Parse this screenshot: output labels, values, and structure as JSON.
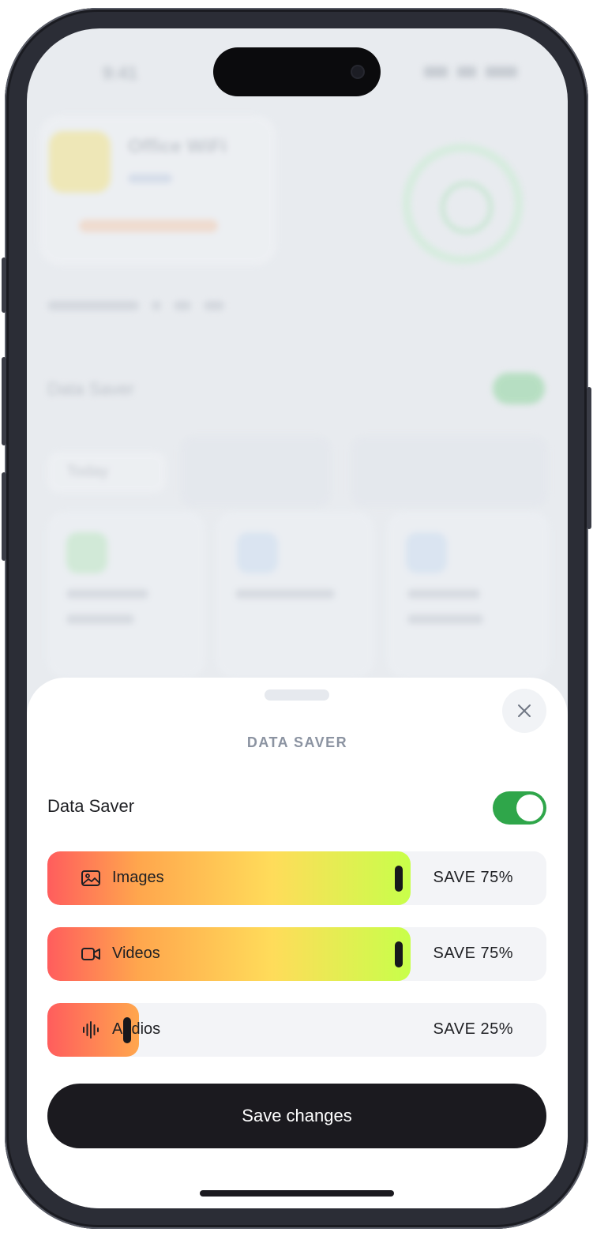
{
  "background": {
    "status_time": "9:41",
    "network_title": "Office WiFi",
    "data_saver_label": "Data Saver",
    "today_label": "Today"
  },
  "sheet": {
    "title": "DATA SAVER",
    "data_saver": {
      "label": "Data Saver",
      "enabled": true
    },
    "sliders": [
      {
        "icon": "image-icon",
        "label": "Images",
        "value_text": "SAVE 75%",
        "percent": 75
      },
      {
        "icon": "video-camera-icon",
        "label": "Videos",
        "value_text": "SAVE 75%",
        "percent": 75
      },
      {
        "icon": "audio-waveform-icon",
        "label": "Audios",
        "value_text": "SAVE 25%",
        "percent": 25
      }
    ],
    "save_button_label": "Save changes"
  },
  "colors": {
    "toggle_on": "#2fa64a",
    "button_dark": "#1b1a1f",
    "gradient_start": "#ff5d5d",
    "gradient_mid": "#ffdc5a",
    "gradient_end": "#c8ff4a"
  }
}
